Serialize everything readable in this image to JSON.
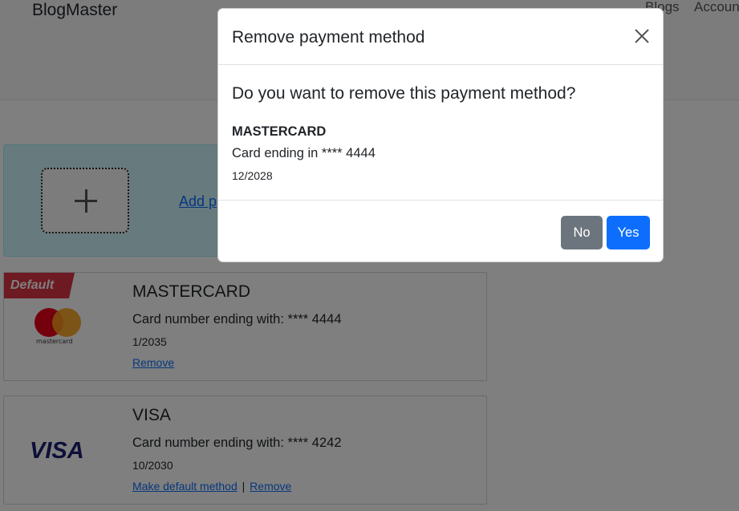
{
  "navbar": {
    "brand": "BlogMaster",
    "links": [
      "Blogs",
      "Accoun"
    ]
  },
  "add_panel": {
    "link_label": "Add p"
  },
  "cards": [
    {
      "default_badge": "Default",
      "logo": "mastercard-logo",
      "logo_text": "mastercard",
      "title": "MASTERCARD",
      "number": "Card number ending with: **** 4444",
      "expiry": "1/2035",
      "actions": [
        "Remove"
      ]
    },
    {
      "logo": "visa-logo",
      "logo_text": "VISA",
      "title": "VISA",
      "number": "Card number ending with: **** 4242",
      "expiry": "10/2030",
      "actions": [
        "Make default method",
        "Remove"
      ],
      "separator": "|"
    }
  ],
  "modal": {
    "title": "Remove payment method",
    "question": "Do you want to remove this payment method?",
    "card_brand": "MASTERCARD",
    "card_number": "Card ending in **** 4444",
    "card_expiry": "12/2028",
    "no_label": "No",
    "yes_label": "Yes"
  },
  "colors": {
    "primary": "#0d6efd",
    "secondary": "#6c757d",
    "danger": "#dc3545",
    "info_bg": "#cff4fc"
  }
}
